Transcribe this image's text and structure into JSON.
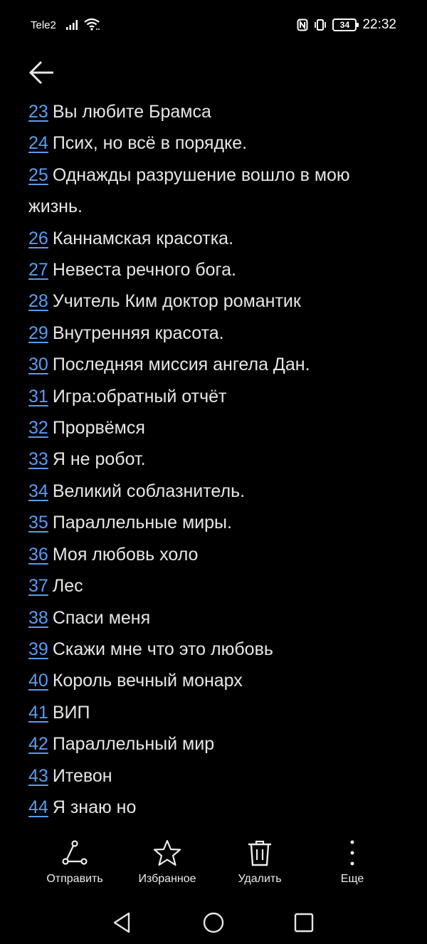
{
  "status_bar": {
    "carrier": "Tele2",
    "battery": "34",
    "time": "22:32"
  },
  "list": [
    {
      "num": "23",
      "title": "Вы любите Брамса"
    },
    {
      "num": "24",
      "title": "Псих, но всё в порядке."
    },
    {
      "num": "25",
      "title": "Однажды разрушение вошло в мою жизнь."
    },
    {
      "num": "26",
      "title": "Каннамская красотка."
    },
    {
      "num": "27",
      "title": "Невеста речного бога."
    },
    {
      "num": "28",
      "title": "Учитель Ким доктор романтик"
    },
    {
      "num": "29",
      "title": "Внутренняя красота."
    },
    {
      "num": "30",
      "title": "Последняя миссия ангела Дан."
    },
    {
      "num": "31",
      "title": "Игра:обратный отчёт"
    },
    {
      "num": "32",
      "title": "Прорвёмся"
    },
    {
      "num": "33",
      "title": "Я не робот."
    },
    {
      "num": "34",
      "title": "Великий соблазнитель."
    },
    {
      "num": "35",
      "title": "Параллельные миры."
    },
    {
      "num": "36",
      "title": "Моя любовь холо"
    },
    {
      "num": "37",
      "title": "Лес"
    },
    {
      "num": "38",
      "title": "Спаси меня"
    },
    {
      "num": "39",
      "title": "Скажи мне что это любовь"
    },
    {
      "num": "40",
      "title": "Король вечный монарх"
    },
    {
      "num": "41",
      "title": "ВИП"
    },
    {
      "num": "42",
      "title": "Параллельный мир"
    },
    {
      "num": "43",
      "title": "Итевон"
    },
    {
      "num": "44",
      "title": "Я знаю но"
    }
  ],
  "actions": {
    "send_label": "Отправить",
    "favorite_label": "Избранное",
    "delete_label": "Удалить",
    "more_label": "Еще"
  },
  "colors": {
    "background": "#000000",
    "link": "#5b9bf0",
    "text": "#e6e6e6"
  }
}
